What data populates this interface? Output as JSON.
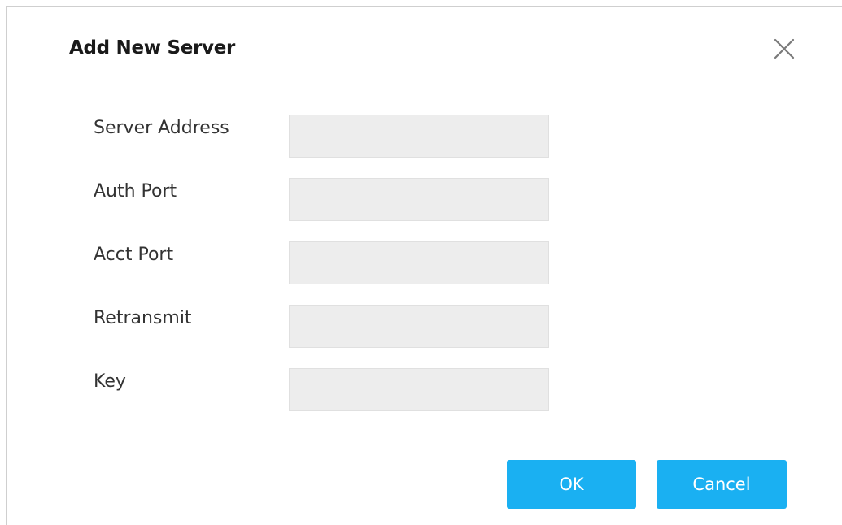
{
  "dialog": {
    "title": "Add New Server",
    "close_icon": "close-icon"
  },
  "form": {
    "fields": [
      {
        "label": "Server Address",
        "value": "",
        "placeholder": ""
      },
      {
        "label": "Auth Port",
        "value": "",
        "placeholder": ""
      },
      {
        "label": "Acct Port",
        "value": "",
        "placeholder": ""
      },
      {
        "label": "Retransmit",
        "value": "",
        "placeholder": ""
      },
      {
        "label": "Key",
        "value": "",
        "placeholder": ""
      }
    ]
  },
  "buttons": {
    "ok_label": "OK",
    "cancel_label": "Cancel"
  },
  "colors": {
    "primary_button": "#1ab0f2",
    "input_background": "#ededed",
    "divider": "#b8b8b8"
  }
}
